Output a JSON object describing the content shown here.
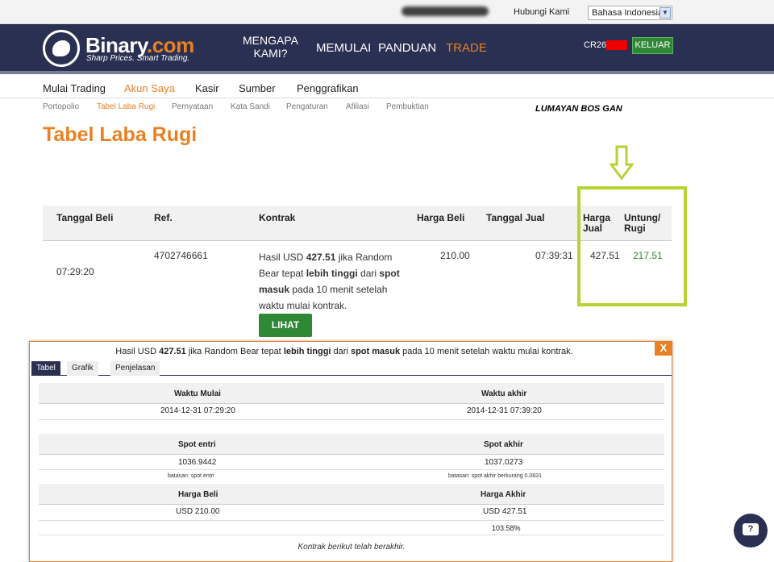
{
  "topbar": {
    "contact": "Hubungi Kami",
    "language": "Bahasa Indonesia"
  },
  "header": {
    "brand_main": "Binary",
    "brand_tld": ".com",
    "tagline": "Sharp Prices. Smart Trading.",
    "nav": {
      "why": "MENGAPA KAMI?",
      "start": "MEMULAI",
      "guide": "PANDUAN",
      "trade": "TRADE"
    },
    "account_prefix": "CR26",
    "logout": "KELUAR"
  },
  "subnav": [
    "Mulai Trading",
    "Akun Saya",
    "Kasir",
    "Sumber",
    "Penggrafikan"
  ],
  "tertnav": [
    "Portopolio",
    "Tabel Laba Rugi",
    "Pernyataan",
    "Kata Sandi",
    "Pengaturan",
    "Afiliasi",
    "Pembuktian"
  ],
  "annotation": "LUMAYAN BOS GAN",
  "page_title": "Tabel Laba Rugi",
  "table": {
    "headers": {
      "buy_date": "Tanggal Beli",
      "ref": "Ref.",
      "contract": "Kontrak",
      "buy_price": "Harga Beli",
      "sell_date": "Tanggal Jual",
      "sell_price": "Harga Jual",
      "profit": "Untung/ Rugi"
    },
    "row": {
      "buy_time": "07:29:20",
      "ref": "4702746661",
      "contract_pre": "Hasil USD ",
      "contract_amount": "427.51",
      "contract_mid1": " jika Random Bear tepat ",
      "contract_higher": "lebih tinggi",
      "contract_mid2": " dari ",
      "contract_spot": "spot masuk",
      "contract_post": " pada 10 menit setelah waktu mulai kontrak.",
      "buy_price": "210.00",
      "sell_time": "07:39:31",
      "sell_price": "427.51",
      "profit": "217.51",
      "view_button": "LIHAT"
    }
  },
  "popup": {
    "title_pre": "Hasil USD ",
    "title_amount": "427.51",
    "title_mid1": " jika Random Bear tepat ",
    "title_higher": "lebih tinggi",
    "title_mid2": " dari ",
    "title_spot": "spot masuk",
    "title_post": " pada 10 menit setelah waktu mulai kontrak.",
    "close": "X",
    "tabs": [
      "Tabel",
      "Grafik",
      "Penjelasan"
    ],
    "start_label": "Waktu Mulai",
    "end_label": "Waktu akhir",
    "start_value": "2014-12-31 07:29:20",
    "end_value": "2014-12-31 07:39:20",
    "spot_entry_label": "Spot entri",
    "spot_exit_label": "Spot akhir",
    "spot_entry_value": "1036.9442",
    "spot_exit_value": "1037.0273",
    "entry_barrier_note": "batasan: spot entri",
    "exit_barrier_note": "batasan: spot akhir berkurang 0.0831",
    "buy_label": "Harga Beli",
    "end_price_label": "Harga Akhir",
    "buy_value": "USD 210.00",
    "end_price_value": "USD 427.51",
    "return_pct": "103.58%",
    "ended_note": "Kontrak berikut telah berakhir."
  }
}
